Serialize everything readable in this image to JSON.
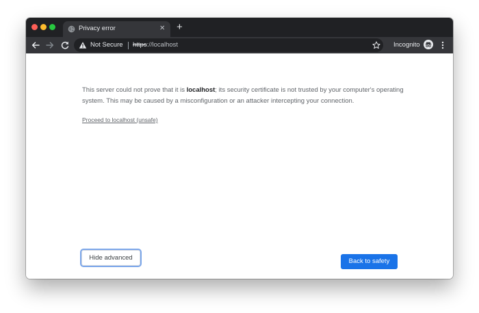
{
  "tab": {
    "title": "Privacy error",
    "close_glyph": "✕",
    "favicon": "globe-icon"
  },
  "new_tab_glyph": "+",
  "toolbar": {
    "back_icon": "back-arrow-icon",
    "forward_icon": "forward-arrow-icon",
    "reload_icon": "reload-icon",
    "security_icon": "warning-triangle-icon",
    "security_label": "Not Secure",
    "url_scheme": "https",
    "url_host": "://localhost",
    "bookmark_icon": "star-icon",
    "profile_label": "Incognito",
    "profile_icon": "incognito-icon",
    "menu_icon": "three-dots-menu-icon"
  },
  "interstitial": {
    "details_before": "This server could not prove that it is ",
    "details_domain": "localhost",
    "details_after": "; its security certificate is not trusted by your computer's operating system. This may be caused by a misconfiguration or an attacker intercepting your connection.",
    "proceed_link": "Proceed to localhost (unsafe)",
    "hide_advanced_label": "Hide advanced",
    "back_to_safety_label": "Back to safety"
  },
  "colors": {
    "frame": "#202124",
    "toolbar": "#35363a",
    "primary_button": "#1a73e8",
    "focus_ring": "#7ba6ea",
    "body_text": "#5f6368"
  }
}
